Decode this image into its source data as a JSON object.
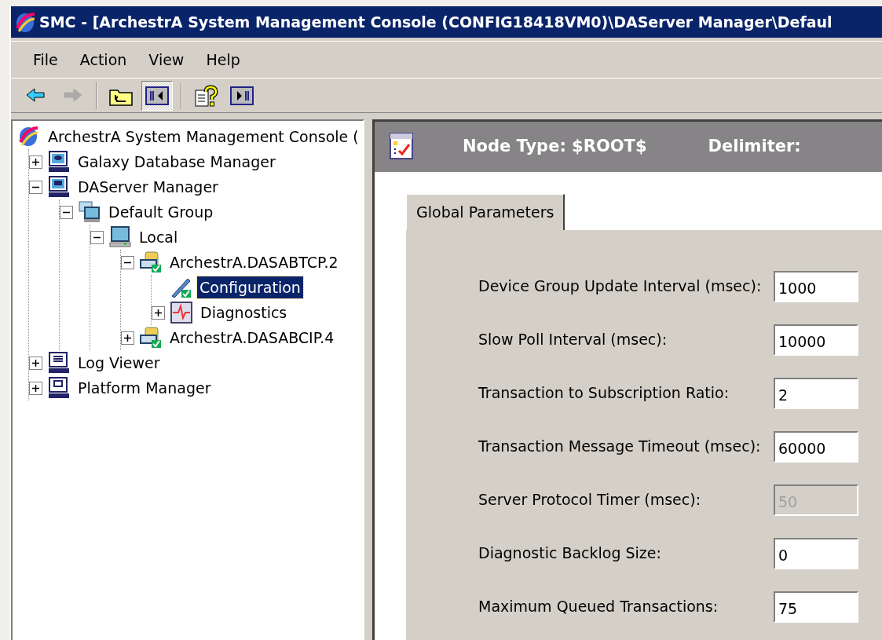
{
  "window": {
    "title": "SMC - [ArchestrA System Management Console (CONFIG18418VM0)\\DAServer Manager\\Defaul"
  },
  "menu": [
    "File",
    "Action",
    "View",
    "Help"
  ],
  "toolbar": [
    {
      "kind": "back",
      "pressed": false,
      "disabled": false
    },
    {
      "kind": "forward",
      "pressed": false,
      "disabled": true
    },
    {
      "kind": "separator"
    },
    {
      "kind": "up",
      "pressed": false,
      "disabled": false
    },
    {
      "kind": "tree",
      "pressed": true,
      "disabled": false
    },
    {
      "kind": "separator"
    },
    {
      "kind": "help",
      "pressed": false,
      "disabled": false
    },
    {
      "kind": "pane",
      "pressed": false,
      "disabled": false
    }
  ],
  "tree": [
    {
      "label": "ArchestrA System Management Console (",
      "kind": "console",
      "selected": false,
      "children": [
        {
          "label": "Galaxy Database Manager",
          "kind": "database",
          "expanded": false,
          "selected": false
        },
        {
          "label": "DAServer Manager",
          "kind": "server",
          "expanded": true,
          "selected": false,
          "children": [
            {
              "label": "Default Group",
              "kind": "group",
              "expanded": true,
              "selected": false,
              "children": [
                {
                  "label": "Local",
                  "kind": "computer",
                  "expanded": true,
                  "selected": false,
                  "children": [
                    {
                      "label": "ArchestrA.DASABTCP.2",
                      "kind": "daserver",
                      "expanded": true,
                      "selected": false,
                      "children": [
                        {
                          "label": "Configuration",
                          "kind": "config",
                          "selected": true
                        },
                        {
                          "label": "Diagnostics",
                          "kind": "diagnostics",
                          "expanded": false,
                          "selected": false
                        }
                      ]
                    },
                    {
                      "label": "ArchestrA.DASABCIP.4",
                      "kind": "daserver",
                      "expanded": false,
                      "selected": false
                    }
                  ]
                }
              ]
            }
          ]
        },
        {
          "label": "Log Viewer",
          "kind": "log",
          "expanded": false,
          "selected": false
        },
        {
          "label": "Platform Manager",
          "kind": "platform",
          "expanded": false,
          "selected": false
        }
      ]
    }
  ],
  "header": {
    "node_type": "Node Type: $ROOT$",
    "delimiter": "Delimiter:"
  },
  "tabs": [
    {
      "label": "Global Parameters",
      "selected": true
    }
  ],
  "fields": [
    {
      "label": "Device Group Update Interval (msec):",
      "value": "1000",
      "disabled": false
    },
    {
      "label": "Slow Poll Interval (msec):",
      "value": "10000",
      "disabled": false
    },
    {
      "label": "Transaction to Subscription Ratio:",
      "value": "2",
      "disabled": false
    },
    {
      "label": "Transaction Message Timeout (msec):",
      "value": "60000",
      "disabled": false
    },
    {
      "label": "Server Protocol Timer (msec):",
      "value": "50",
      "disabled": true
    },
    {
      "label": "Diagnostic Backlog Size:",
      "value": "0",
      "disabled": false
    },
    {
      "label": "Maximum Queued Transactions:",
      "value": "75",
      "disabled": false
    }
  ]
}
